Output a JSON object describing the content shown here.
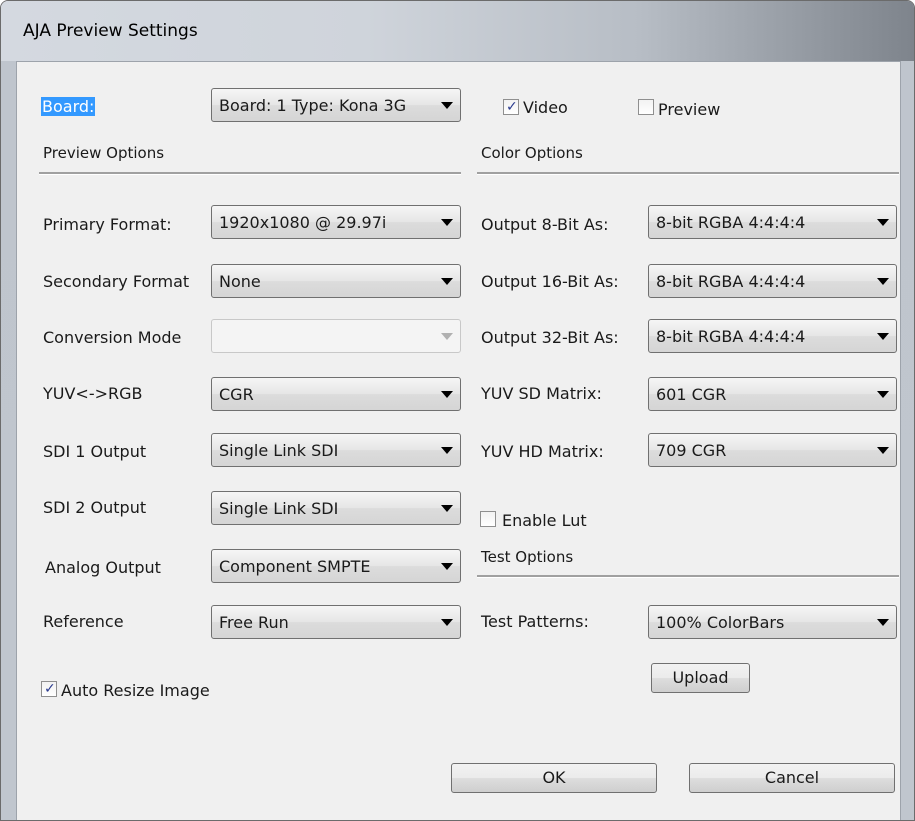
{
  "window": {
    "title": "AJA Preview Settings"
  },
  "board": {
    "label": "Board:",
    "value": "Board: 1 Type: Kona 3G",
    "video_label": "Video",
    "video_checked": true,
    "preview_label": "Preview",
    "preview_checked": false
  },
  "preview_options": {
    "header": "Preview Options",
    "rows": [
      {
        "label": "Primary Format:",
        "value": "1920x1080 @ 29.97i",
        "enabled": true
      },
      {
        "label": "Secondary Format",
        "value": "None",
        "enabled": true
      },
      {
        "label": "Conversion Mode",
        "value": "",
        "enabled": false
      },
      {
        "label": "YUV<->RGB",
        "value": "CGR",
        "enabled": true
      },
      {
        "label": "SDI 1 Output",
        "value": "Single Link SDI",
        "enabled": true
      },
      {
        "label": "SDI 2 Output",
        "value": "Single Link SDI",
        "enabled": true
      },
      {
        "label": "Analog Output",
        "value": "Component SMPTE",
        "enabled": true
      },
      {
        "label": "Reference",
        "value": "Free Run",
        "enabled": true
      }
    ],
    "auto_resize_label": "Auto Resize Image",
    "auto_resize_checked": true
  },
  "color_options": {
    "header": "Color Options",
    "rows": [
      {
        "label": "Output  8-Bit As:",
        "value": "8-bit RGBA 4:4:4:4"
      },
      {
        "label": "Output 16-Bit As:",
        "value": "8-bit RGBA 4:4:4:4"
      },
      {
        "label": "Output 32-Bit As:",
        "value": "8-bit RGBA 4:4:4:4"
      },
      {
        "label": "YUV SD Matrix:",
        "value": "601 CGR"
      },
      {
        "label": "YUV HD Matrix:",
        "value": "709 CGR"
      }
    ],
    "enable_lut_label": "Enable Lut",
    "enable_lut_checked": false
  },
  "test_options": {
    "header": "Test Options",
    "patterns_label": "Test Patterns:",
    "patterns_value": "100% ColorBars",
    "upload_label": "Upload"
  },
  "footer": {
    "ok_label": "OK",
    "cancel_label": "Cancel"
  }
}
